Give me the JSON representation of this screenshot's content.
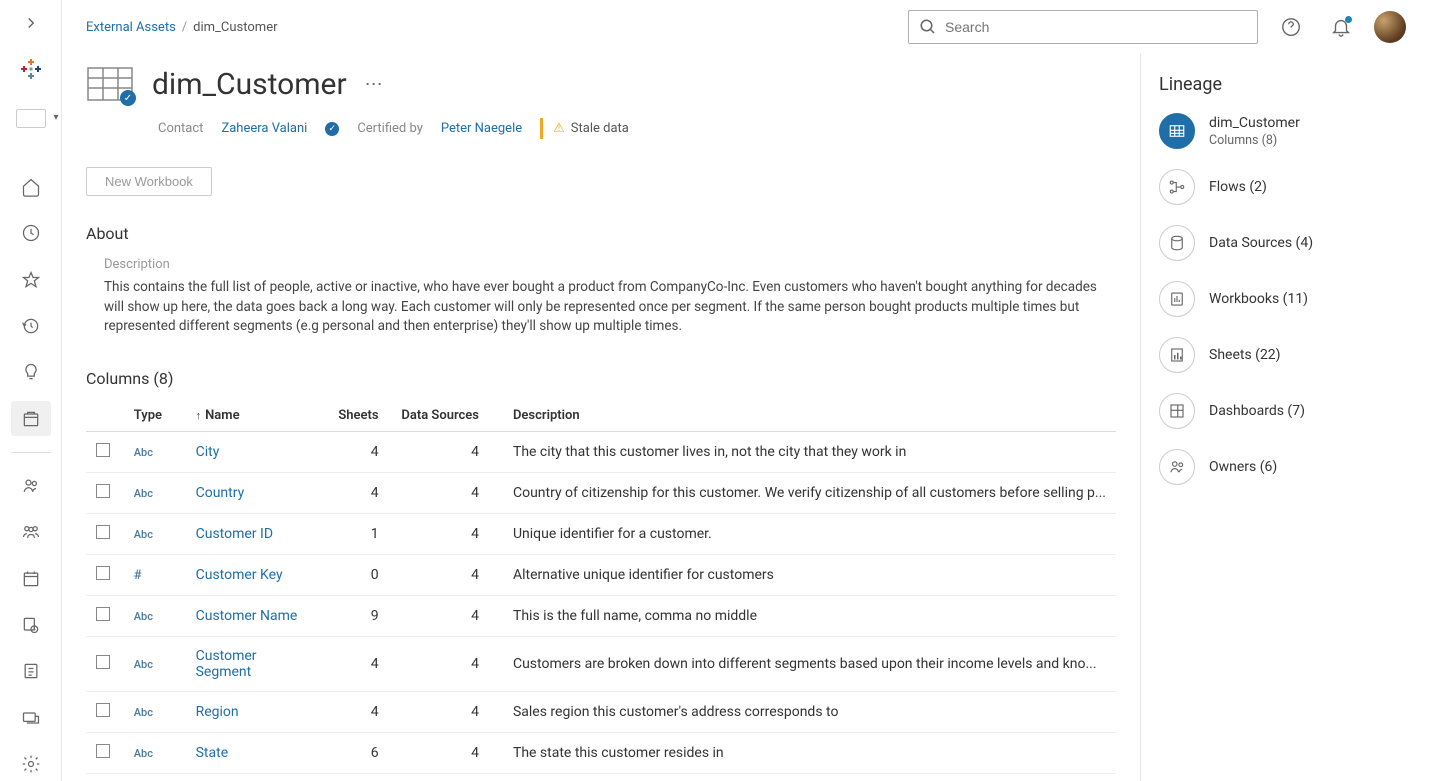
{
  "breadcrumb": {
    "root": "External Assets",
    "current": "dim_Customer"
  },
  "search": {
    "placeholder": "Search"
  },
  "title": "dim_Customer",
  "meta": {
    "contact_label": "Contact",
    "contact_value": "Zaheera Valani",
    "certified_label": "Certified by",
    "certified_value": "Peter Naegele",
    "stale_label": "Stale data"
  },
  "actions": {
    "new_workbook": "New Workbook"
  },
  "about": {
    "heading": "About",
    "description_label": "Description",
    "description": "This contains the full list of people, active or inactive, who have ever bought a product from CompanyCo-Inc. Even customers who haven't bought anything for decades will show up here, the data goes back a long way. Each customer will only be represented once per segment. If the same person bought products multiple times but represented different segments (e.g personal and then enterprise) they'll show up multiple times."
  },
  "columns": {
    "heading": "Columns (8)",
    "headers": {
      "type": "Type",
      "name": "Name",
      "sheets": "Sheets",
      "data_sources": "Data Sources",
      "description": "Description"
    },
    "rows": [
      {
        "type": "Abc",
        "name": "City",
        "sheets": "4",
        "data_sources": "4",
        "desc": "The city that this customer lives in, not the city that they work in"
      },
      {
        "type": "Abc",
        "name": "Country",
        "sheets": "4",
        "data_sources": "4",
        "desc": "Country of citizenship for this customer. We verify citizenship of all customers before selling p..."
      },
      {
        "type": "Abc",
        "name": "Customer ID",
        "sheets": "1",
        "data_sources": "4",
        "desc": "Unique identifier for a customer."
      },
      {
        "type": "#",
        "name": "Customer Key",
        "sheets": "0",
        "data_sources": "4",
        "desc": "Alternative unique identifier for customers"
      },
      {
        "type": "Abc",
        "name": "Customer Name",
        "sheets": "9",
        "data_sources": "4",
        "desc": "This is the full name, comma no middle"
      },
      {
        "type": "Abc",
        "name": "Customer Segment",
        "sheets": "4",
        "data_sources": "4",
        "desc": "Customers are broken down into different segments based upon their income levels and kno..."
      },
      {
        "type": "Abc",
        "name": "Region",
        "sheets": "4",
        "data_sources": "4",
        "desc": "Sales region this customer's address corresponds to"
      },
      {
        "type": "Abc",
        "name": "State",
        "sheets": "6",
        "data_sources": "4",
        "desc": "The state this customer resides in"
      }
    ]
  },
  "lineage": {
    "heading": "Lineage",
    "primary": {
      "title": "dim_Customer",
      "subtitle": "Columns (8)"
    },
    "items": [
      {
        "label": "Flows (2)",
        "icon": "flow"
      },
      {
        "label": "Data Sources (4)",
        "icon": "datasource"
      },
      {
        "label": "Workbooks (11)",
        "icon": "workbook"
      },
      {
        "label": "Sheets (22)",
        "icon": "sheet"
      },
      {
        "label": "Dashboards (7)",
        "icon": "dashboard"
      },
      {
        "label": "Owners (6)",
        "icon": "owners"
      }
    ]
  }
}
